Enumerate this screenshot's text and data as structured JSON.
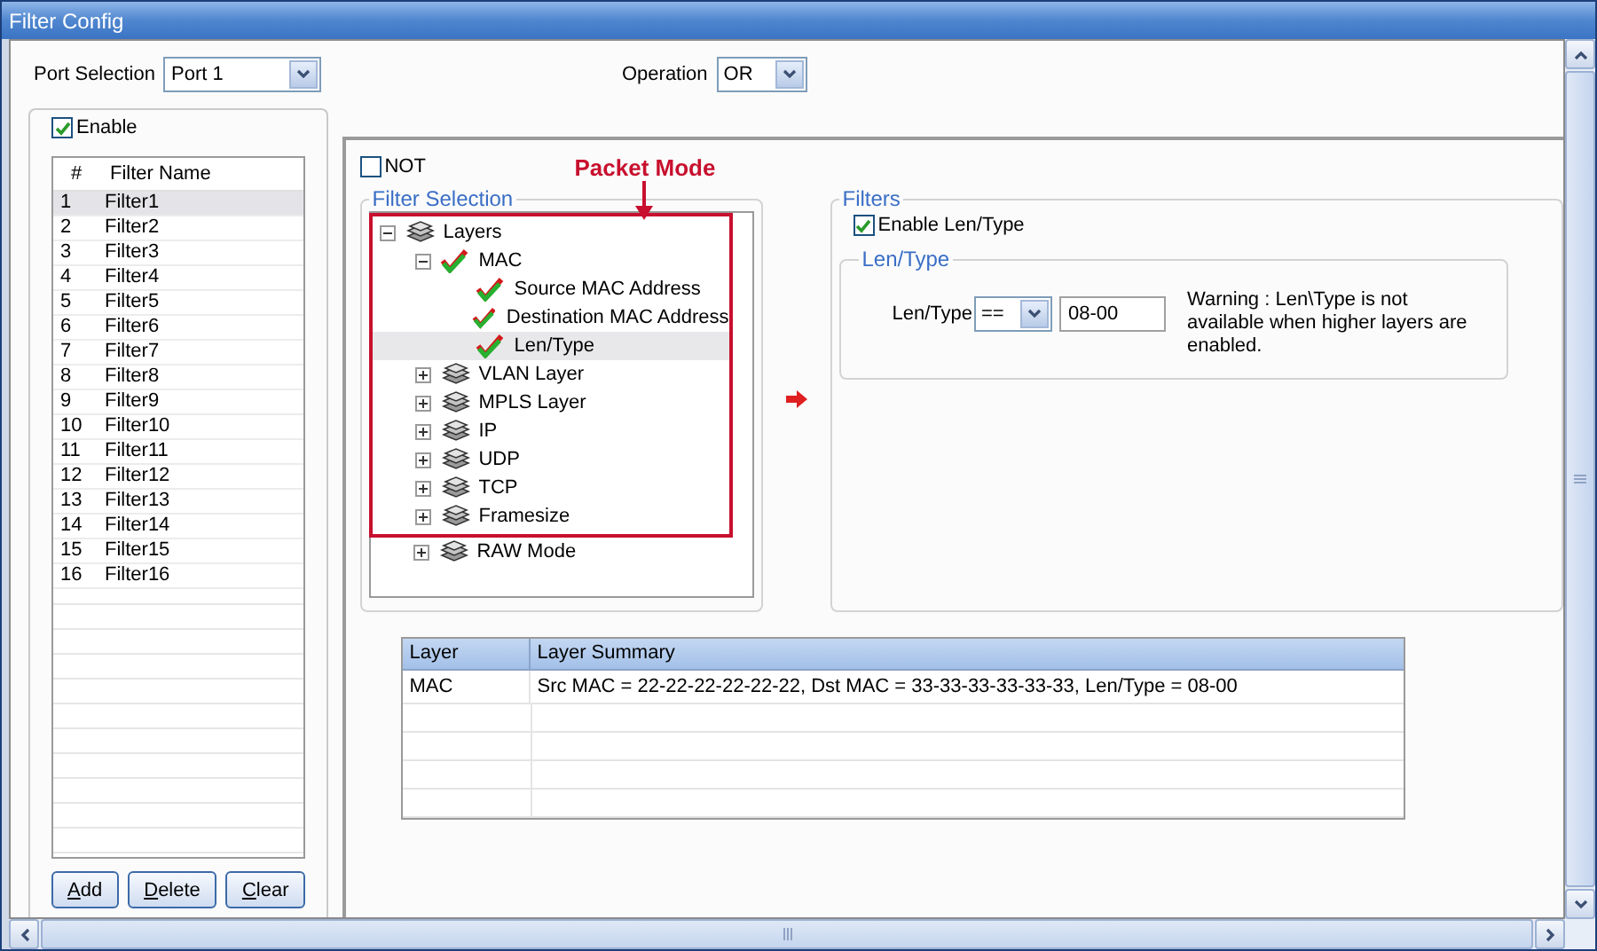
{
  "window": {
    "title": "Filter Config"
  },
  "port_selection": {
    "label": "Port Selection",
    "value": "Port 1"
  },
  "operation": {
    "label": "Operation",
    "value": "OR"
  },
  "enable": {
    "label": "Enable",
    "checked": true
  },
  "filter_list": {
    "columns": [
      "#",
      "Filter Name"
    ],
    "rows": [
      {
        "number": "1",
        "name": "Filter1",
        "selected": true
      },
      {
        "number": "2",
        "name": "Filter2",
        "selected": false
      },
      {
        "number": "3",
        "name": "Filter3",
        "selected": false
      },
      {
        "number": "4",
        "name": "Filter4",
        "selected": false
      },
      {
        "number": "5",
        "name": "Filter5",
        "selected": false
      },
      {
        "number": "6",
        "name": "Filter6",
        "selected": false
      },
      {
        "number": "7",
        "name": "Filter7",
        "selected": false
      },
      {
        "number": "8",
        "name": "Filter8",
        "selected": false
      },
      {
        "number": "9",
        "name": "Filter9",
        "selected": false
      },
      {
        "number": "10",
        "name": "Filter10",
        "selected": false
      },
      {
        "number": "11",
        "name": "Filter11",
        "selected": false
      },
      {
        "number": "12",
        "name": "Filter12",
        "selected": false
      },
      {
        "number": "13",
        "name": "Filter13",
        "selected": false
      },
      {
        "number": "14",
        "name": "Filter14",
        "selected": false
      },
      {
        "number": "15",
        "name": "Filter15",
        "selected": false
      },
      {
        "number": "16",
        "name": "Filter16",
        "selected": false
      }
    ]
  },
  "buttons": [
    {
      "access_key": "A",
      "rest": "dd"
    },
    {
      "access_key": "D",
      "rest": "elete"
    },
    {
      "access_key": "C",
      "rest": "lear"
    }
  ],
  "not": {
    "label": "NOT",
    "checked": false
  },
  "annotation": {
    "text": "Packet Mode"
  },
  "filter_selection": {
    "title": "Filter Selection",
    "tree": [
      {
        "label": "Layers",
        "kind": "layer",
        "checked": false,
        "expanded": true,
        "selected": false,
        "highlighted": true,
        "children": [
          {
            "label": "MAC",
            "kind": "layer",
            "checked": true,
            "expanded": true,
            "selected": false,
            "highlighted": true,
            "children": [
              {
                "label": "Source MAC Address",
                "kind": "field",
                "checked": true,
                "selected": false,
                "highlighted": true
              },
              {
                "label": "Destination MAC Address",
                "kind": "field",
                "checked": true,
                "selected": false,
                "highlighted": true
              },
              {
                "label": "Len/Type",
                "kind": "field",
                "checked": true,
                "selected": true,
                "highlighted": true
              }
            ]
          },
          {
            "label": "VLAN Layer",
            "kind": "layer",
            "checked": false,
            "expanded": false,
            "selected": false,
            "highlighted": true
          },
          {
            "label": "MPLS Layer",
            "kind": "layer",
            "checked": false,
            "expanded": false,
            "selected": false,
            "highlighted": true
          },
          {
            "label": "IP",
            "kind": "layer",
            "checked": false,
            "expanded": false,
            "selected": false,
            "highlighted": true
          },
          {
            "label": "UDP",
            "kind": "layer",
            "checked": false,
            "expanded": false,
            "selected": false,
            "highlighted": true
          },
          {
            "label": "TCP",
            "kind": "layer",
            "checked": false,
            "expanded": false,
            "selected": false,
            "highlighted": true
          },
          {
            "label": "Framesize",
            "kind": "layer",
            "checked": false,
            "expanded": false,
            "selected": false,
            "highlighted": true
          },
          {
            "label": "RAW Mode",
            "kind": "layer",
            "checked": false,
            "expanded": false,
            "selected": false,
            "highlighted": false
          }
        ]
      }
    ]
  },
  "filters": {
    "title": "Filters",
    "enable": {
      "label": "Enable Len/Type",
      "checked": true
    },
    "group": {
      "title": "Len/Type",
      "label": "Len/Type",
      "operator": "==",
      "value": "08-00",
      "warning": "Warning : Len\\Type is not available when higher layers are enabled."
    }
  },
  "summary_table": {
    "columns": [
      "Layer",
      "Layer Summary"
    ],
    "rows": [
      [
        "MAC",
        "Src MAC = 22-22-22-22-22-22, Dst MAC = 33-33-33-33-33-33, Len/Type  = 08-00"
      ]
    ]
  }
}
